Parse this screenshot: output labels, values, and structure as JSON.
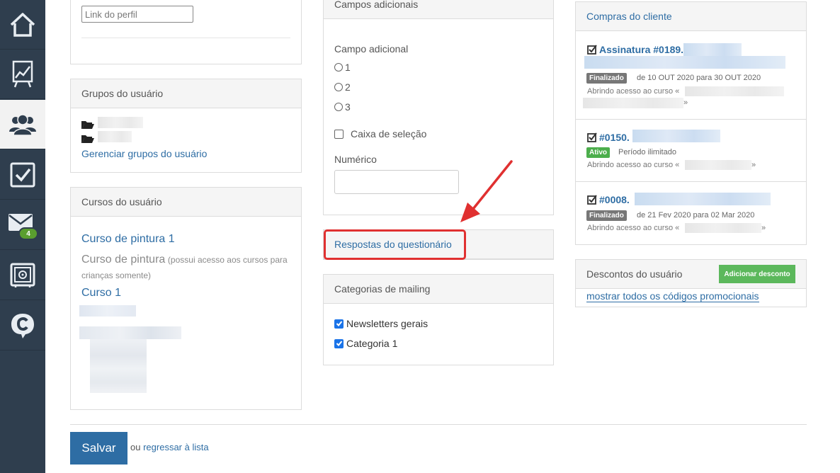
{
  "sidebar": {
    "items": [
      {
        "icon": "home-icon"
      },
      {
        "icon": "chart-board-icon"
      },
      {
        "icon": "users-icon",
        "active": true
      },
      {
        "icon": "checkbox-icon"
      },
      {
        "icon": "mail-icon",
        "badge": "4"
      },
      {
        "icon": "safe-icon"
      },
      {
        "icon": "chat-c-icon"
      }
    ]
  },
  "profile": {
    "link_placeholder": "Link do perfil"
  },
  "groups": {
    "title": "Grupos do usuário",
    "manage_link": "Gerenciar grupos do usuário"
  },
  "courses": {
    "title": "Cursos do usuário",
    "items": [
      {
        "name": "Curso de pintura 1",
        "note": ""
      },
      {
        "name": "Curso de pintura",
        "note": "(possui acesso aos cursos para crianças somente)"
      },
      {
        "name": "Curso 1",
        "note": ""
      }
    ]
  },
  "additional_fields": {
    "title": "Campos adicionais",
    "field_label": "Campo adicional",
    "options": [
      "1",
      "2",
      "3"
    ],
    "checkbox_label": "Caixa de seleção",
    "numeric_label": "Numérico"
  },
  "questionnaire": {
    "link": "Respostas do questionário"
  },
  "mailing": {
    "title": "Categorias de mailing",
    "items": [
      {
        "label": "Newsletters gerais",
        "checked": true
      },
      {
        "label": "Categoria 1",
        "checked": true
      }
    ]
  },
  "purchases": {
    "title": "Compras do cliente",
    "items": [
      {
        "title": "Assinatura #0189.",
        "status": "Finalizado",
        "period": "de 10 OUT 2020 para 30 OUT 2020",
        "access": "Abrindo acesso ao curso «"
      },
      {
        "title": "#0150.",
        "status": "Ativo",
        "period": "Período ilimitado",
        "access": "Abrindo acesso ao curso «"
      },
      {
        "title": "#0008.",
        "status": "Finalizado",
        "period": "de 21 Fev 2020 para 02 Mar 2020",
        "access": "Abrindo acesso ao curso «"
      }
    ],
    "close_quote": "»"
  },
  "discounts": {
    "title": "Descontos do usuário",
    "add_button": "Adicionar desconto",
    "show_all_link": "mostrar todos os códigos promocionais"
  },
  "footer": {
    "save_button": "Salvar",
    "or_text": "ou",
    "back_link": "regressar à lista"
  },
  "colors": {
    "sidebar_bg": "#2f3e4e",
    "link": "#2e6da4",
    "highlight_red": "#e03030",
    "success_green": "#5cb85c"
  }
}
